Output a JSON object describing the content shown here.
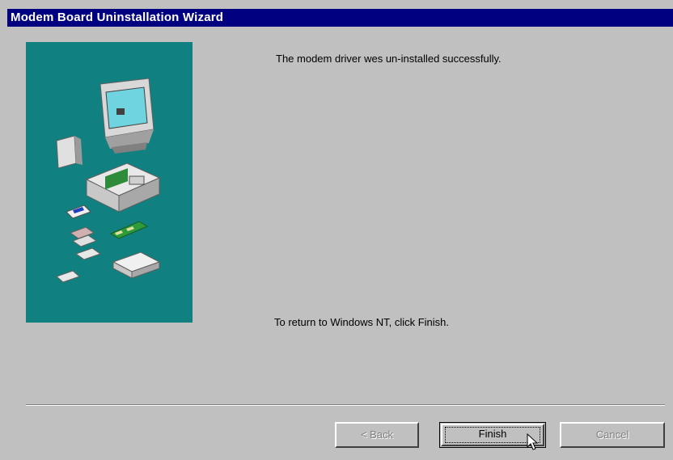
{
  "window": {
    "title": "Modem Board Uninstallation Wizard"
  },
  "content": {
    "message_success": "The modem driver wes un-installed successfully.",
    "message_return": "To return to Windows NT, click Finish."
  },
  "buttons": {
    "back_label": "< Back",
    "finish_label": "Finish",
    "cancel_label": "Cancel"
  },
  "colors": {
    "title_bar": "#000080",
    "dialog_background": "#c0c0c0",
    "illustration_background": "#108080"
  },
  "icons": {
    "illustration": "computer-hardware-illustration",
    "pointer": "mouse-pointer-icon"
  }
}
